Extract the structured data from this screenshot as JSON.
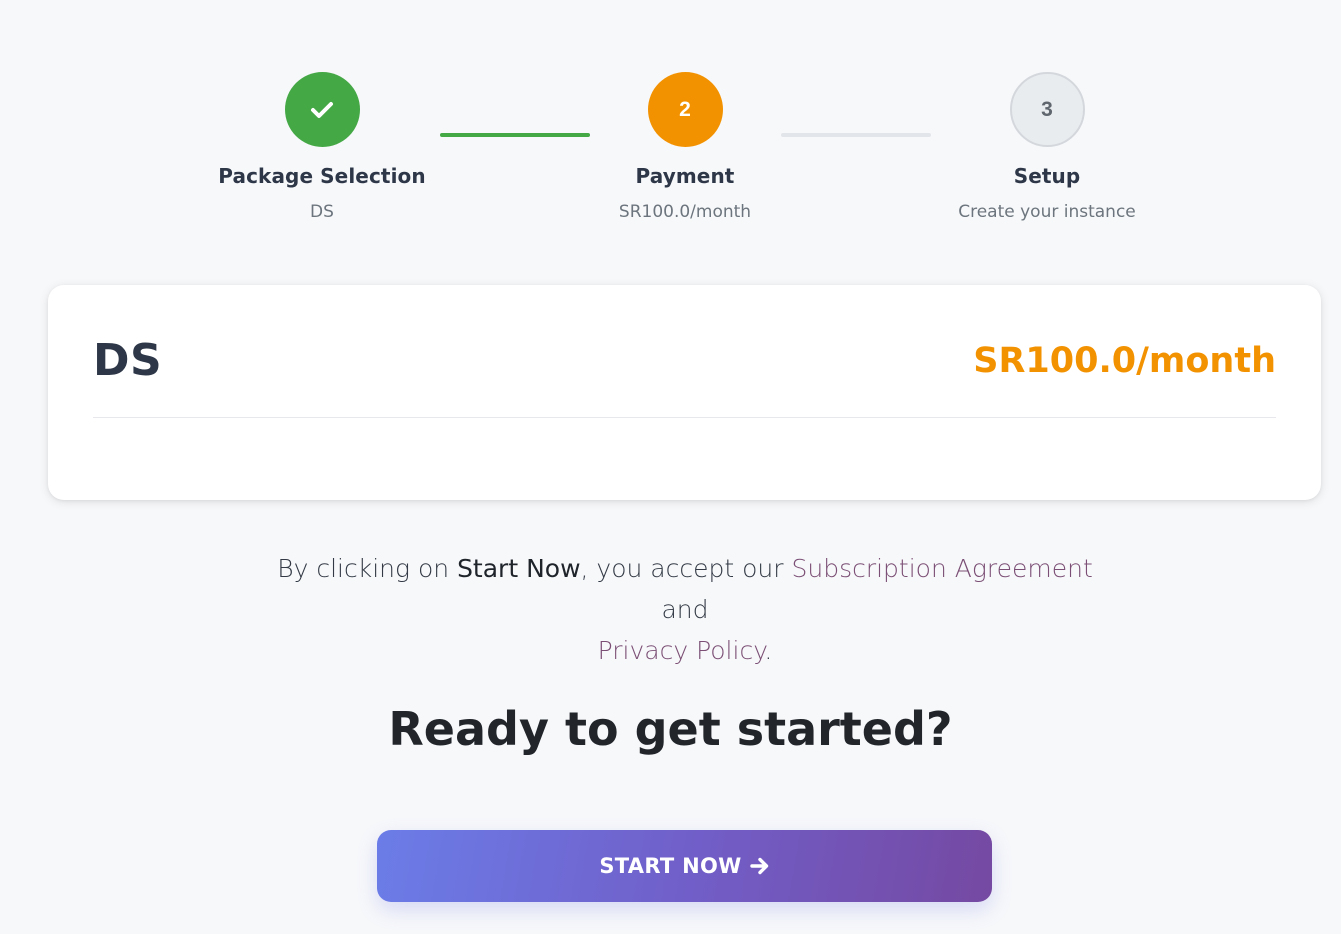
{
  "stepper": {
    "steps": [
      {
        "title": "Package Selection",
        "subtitle": "DS",
        "state": "completed",
        "icon": "check-icon"
      },
      {
        "title": "Payment",
        "subtitle": "SR100.0/month",
        "state": "active",
        "number": "2"
      },
      {
        "title": "Setup",
        "subtitle": "Create your instance",
        "state": "pending",
        "number": "3"
      }
    ],
    "colors": {
      "completed": "#44a845",
      "active": "#f39200",
      "pending": "#e9ecef"
    }
  },
  "package_card": {
    "name": "DS",
    "price": "SR100.0/month"
  },
  "terms": {
    "prefix": "By clicking on ",
    "emphasis": "Start Now",
    "middle": ", you accept our ",
    "subscription_link": "Subscription Agreement",
    "conjunction": " and",
    "privacy_link": "Privacy Policy",
    "suffix": "."
  },
  "cta": {
    "heading": "Ready to get started?",
    "button_label": "START NOW",
    "button_icon": "arrow-right-icon"
  }
}
